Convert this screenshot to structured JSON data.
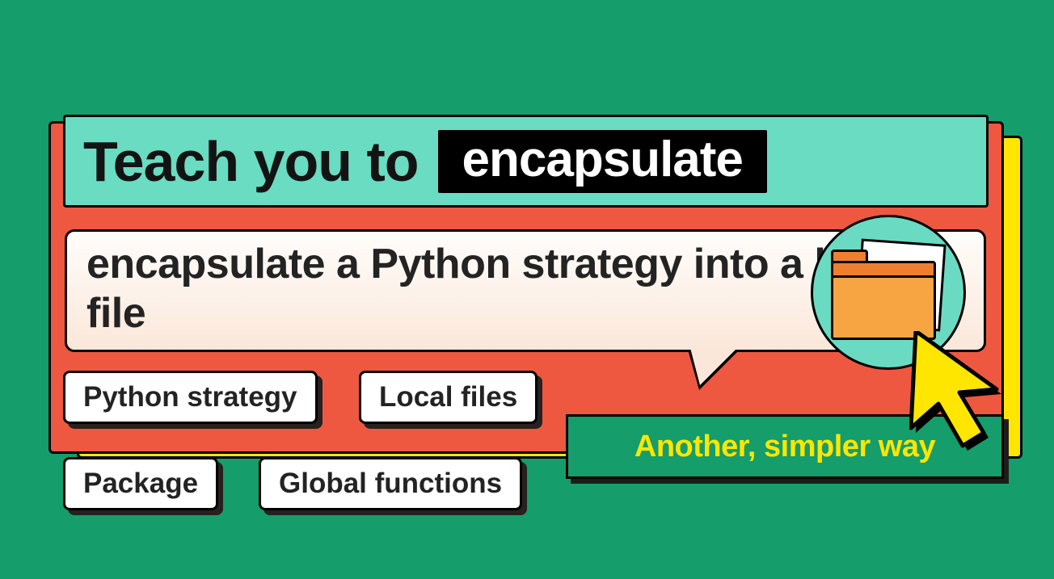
{
  "title": {
    "lead": "Teach you to",
    "highlight": "encapsulate"
  },
  "description": "encapsulate a Python strategy into a local file",
  "tags": {
    "t1": "Python strategy",
    "t2": "Local files",
    "t3": "Package",
    "t4": "Global functions"
  },
  "callout": "Another, simpler way",
  "icons": {
    "folder": "folder-icon",
    "cursor": "cursor-icon"
  }
}
